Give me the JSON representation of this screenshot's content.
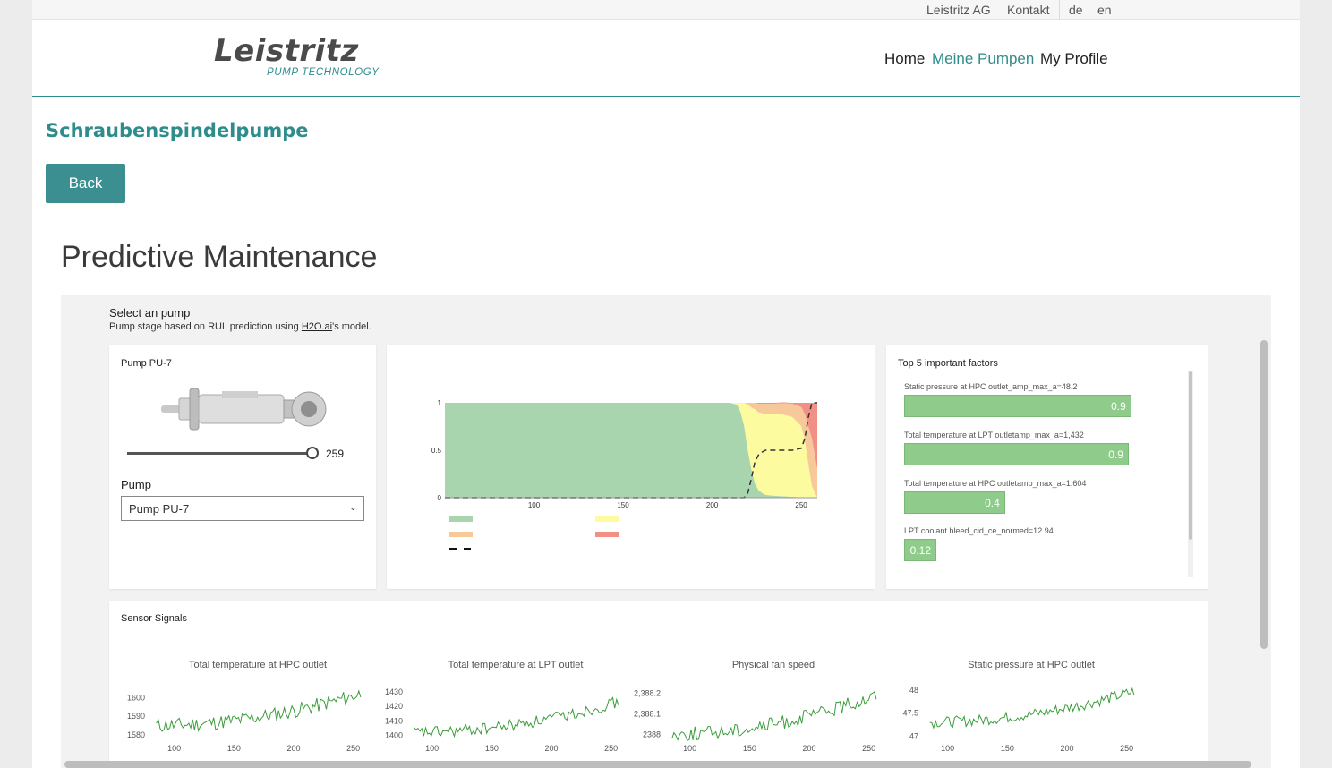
{
  "topbar": {
    "company": "Leistritz AG",
    "contact": "Kontakt",
    "lang_de": "de",
    "lang_en": "en"
  },
  "logo": {
    "name": "Leistritz",
    "tagline": "PUMP TECHNOLOGY"
  },
  "nav": {
    "home": "Home",
    "pumps": "Meine Pumpen",
    "profile": "My Profile"
  },
  "page_title": "Schraubenspindelpumpe",
  "back_label": "Back",
  "section_title": "Predictive Maintenance",
  "selector": {
    "title": "Select an pump",
    "subtitle_before": "Pump stage based on RUL prediction using ",
    "link": "H2O.ai",
    "subtitle_after": "'s model."
  },
  "pump_card": {
    "title": "Pump PU-7",
    "slider_value": "259",
    "slider_fraction": 1.0,
    "select_label": "Pump",
    "select_value": "Pump PU-7"
  },
  "factors": {
    "title": "Top 5 important factors",
    "items": [
      {
        "label": "Static pressure at HPC outlet_amp_max_a=48.2",
        "value": "0.9",
        "fraction": 0.9
      },
      {
        "label": "Total temperature at LPT outletamp_max_a=1,432",
        "value": "0.9",
        "fraction": 0.89
      },
      {
        "label": "Total temperature at HPC outletamp_max_a=1,604",
        "value": "0.4",
        "fraction": 0.4
      },
      {
        "label": "LPT coolant bleed_cid_ce_normed=12.94",
        "value": "0.12",
        "fraction": 0.12
      }
    ]
  },
  "colors": {
    "accent": "#2f8c8c",
    "green": "#a8d5ae",
    "yellow": "#fcfb9f",
    "orange": "#f7c99a",
    "red": "#f28f86",
    "line": "#3a9d3a"
  },
  "sensor_title": "Sensor Signals",
  "chart_data": [
    {
      "type": "area",
      "ylim": [
        0,
        1
      ],
      "xlim": [
        50,
        259
      ],
      "yticks": [
        "0",
        "0.5",
        "1"
      ],
      "xticks": [
        "100",
        "150",
        "200",
        "250"
      ],
      "x": [
        50,
        210,
        214,
        216,
        218,
        220,
        222,
        224,
        226,
        228,
        230,
        235,
        240,
        245,
        250,
        252,
        254,
        256,
        259
      ],
      "series": [
        {
          "values": [
            1,
            1,
            0.98,
            0.9,
            0.75,
            0.5,
            0.3,
            0.15,
            0.08,
            0.05,
            0.03,
            0.02,
            0.015,
            0.01,
            0.005,
            0.004,
            0.003,
            0.002,
            0.0
          ]
        },
        {
          "values": [
            0,
            0,
            0.02,
            0.1,
            0.25,
            0.48,
            0.65,
            0.78,
            0.82,
            0.84,
            0.85,
            0.86,
            0.86,
            0.84,
            0.75,
            0.6,
            0.35,
            0.12,
            0.0
          ]
        },
        {
          "values": [
            0,
            0,
            0,
            0,
            0,
            0.02,
            0.05,
            0.07,
            0.09,
            0.1,
            0.11,
            0.11,
            0.12,
            0.14,
            0.2,
            0.28,
            0.4,
            0.5,
            0.3
          ]
        },
        {
          "values": [
            0,
            0,
            0,
            0,
            0,
            0,
            0,
            0,
            0.01,
            0.01,
            0.01,
            0.01,
            0.01,
            0.01,
            0.045,
            0.116,
            0.247,
            0.378,
            0.7
          ]
        }
      ],
      "dashed": [
        0,
        0,
        0,
        0,
        0,
        0.05,
        0.2,
        0.38,
        0.45,
        0.48,
        0.5,
        0.5,
        0.5,
        0.5,
        0.52,
        0.62,
        0.85,
        1.0,
        1.0
      ]
    },
    {
      "type": "line",
      "title": "Total temperature at HPC outlet",
      "xticks": [
        "100",
        "150",
        "200",
        "250"
      ],
      "yticks": [
        "1580",
        "1590",
        "1600"
      ],
      "ylim": [
        1578,
        1608
      ],
      "xlim": [
        80,
        260
      ],
      "trend": [
        1585,
        1603
      ],
      "noise": 4
    },
    {
      "type": "line",
      "title": "Total temperature at LPT outlet",
      "xticks": [
        "100",
        "150",
        "200",
        "250"
      ],
      "yticks": [
        "1400",
        "1410",
        "1420",
        "1430"
      ],
      "ylim": [
        1398,
        1436
      ],
      "xlim": [
        80,
        260
      ],
      "trend": [
        1402,
        1424
      ],
      "noise": 4
    },
    {
      "type": "line",
      "title": "Physical fan speed",
      "xticks": [
        "100",
        "150",
        "200",
        "250"
      ],
      "yticks": [
        "2388",
        "2,388.1",
        "2,388.2"
      ],
      "ylim": [
        2387.98,
        2388.25
      ],
      "xlim": [
        80,
        260
      ],
      "trend": [
        2388.0,
        2388.2
      ],
      "noise": 0.035
    },
    {
      "type": "line",
      "title": "Static pressure at HPC outlet",
      "xticks": [
        "100",
        "150",
        "200",
        "250"
      ],
      "yticks": [
        "47",
        "47.5",
        "48"
      ],
      "ylim": [
        46.95,
        48.15
      ],
      "xlim": [
        80,
        260
      ],
      "trend": [
        47.3,
        48.0
      ],
      "noise": 0.12
    }
  ]
}
